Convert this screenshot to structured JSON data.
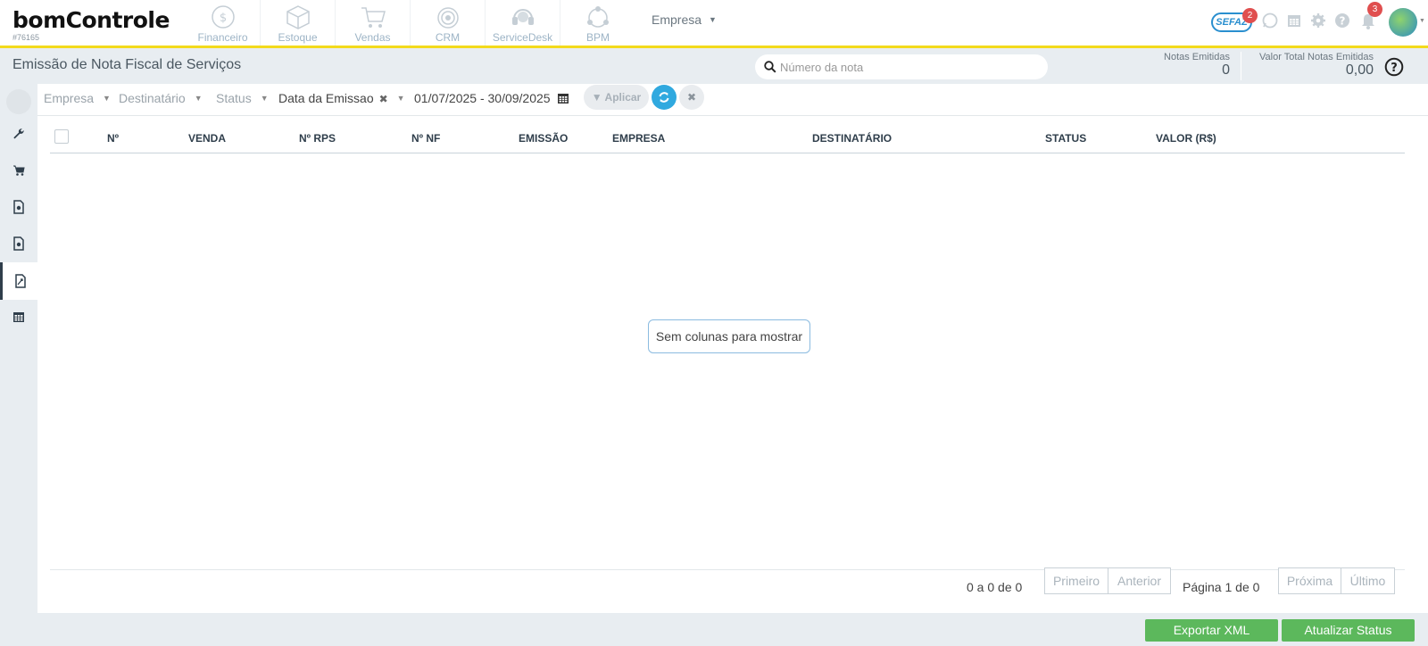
{
  "brand": {
    "logo_text": "bomControle",
    "account_id": "#76165"
  },
  "modules": [
    {
      "label": "Financeiro",
      "icon": "dollar-circle-icon"
    },
    {
      "label": "Estoque",
      "icon": "box-icon"
    },
    {
      "label": "Vendas",
      "icon": "cart-icon"
    },
    {
      "label": "CRM",
      "icon": "target-icon"
    },
    {
      "label": "ServiceDesk",
      "icon": "headset-icon"
    },
    {
      "label": "BPM",
      "icon": "process-icon"
    }
  ],
  "company_menu": "Empresa",
  "notifications": {
    "sefaz_label": "SEFAZ",
    "sefaz_count": "2",
    "bell_count": "3"
  },
  "page": {
    "title": "Emissão de Nota Fiscal de Serviços",
    "search_placeholder": "Número da nota",
    "stats": [
      {
        "label": "Notas Emitidas",
        "value": "0"
      },
      {
        "label": "Valor Total Notas Emitidas",
        "value": "0,00"
      }
    ]
  },
  "filters": {
    "empresa": "Empresa",
    "destinatario": "Destinatário",
    "status": "Status",
    "data_emissao": "Data da Emissao",
    "date_range": "01/07/2025 - 30/09/2025",
    "apply_label": "Aplicar"
  },
  "table": {
    "columns": [
      "Nº",
      "VENDA",
      "Nº RPS",
      "Nº NF",
      "EMISSÃO",
      "EMPRESA",
      "DESTINATÁRIO",
      "STATUS",
      "VALOR (R$)"
    ],
    "empty_message": "Sem colunas para mostrar"
  },
  "pagination": {
    "count": "0 a 0 de 0",
    "first": "Primeiro",
    "previous": "Anterior",
    "page_info": "Página 1 de 0",
    "next": "Próxima",
    "last": "Último"
  },
  "actions": {
    "export_xml": "Exportar XML",
    "update_status": "Atualizar Status"
  },
  "colors": {
    "accent": "#f3da1c",
    "primary": "#30a9df",
    "success": "#5cb85c",
    "badge": "#e04f4f"
  }
}
